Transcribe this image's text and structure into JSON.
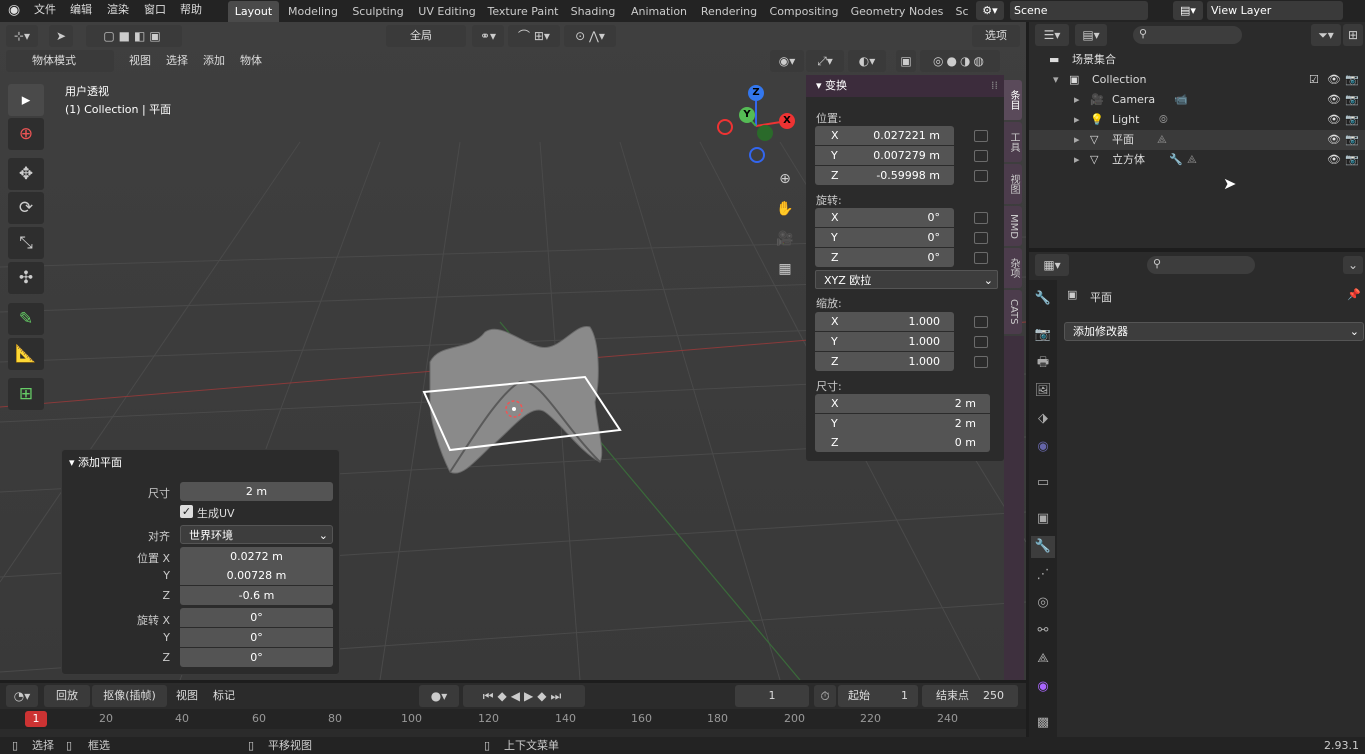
{
  "top_menu": {
    "items": [
      "文件",
      "编辑",
      "渲染",
      "窗口",
      "帮助"
    ],
    "workspaces": [
      "Layout",
      "Modeling",
      "Sculpting",
      "UV Editing",
      "Texture Paint",
      "Shading",
      "Animation",
      "Rendering",
      "Compositing",
      "Geometry Nodes",
      "Sc"
    ],
    "active_workspace": "Layout",
    "scene": "Scene",
    "view_layer": "View Layer"
  },
  "viewport_header": {
    "transform_orientation": "全局",
    "options_label": "选项",
    "mode": "物体模式",
    "menus": [
      "视图",
      "选择",
      "添加",
      "物体"
    ]
  },
  "viewport": {
    "view_name": "用户透视",
    "collection_info": "(1) Collection | 平面",
    "gizmo_axes": [
      "X",
      "Y",
      "Z"
    ]
  },
  "n_panel": {
    "title": "变换",
    "location_label": "位置:",
    "location": [
      {
        "axis": "X",
        "value": "0.027221 m"
      },
      {
        "axis": "Y",
        "value": "0.007279 m"
      },
      {
        "axis": "Z",
        "value": "-0.59998 m"
      }
    ],
    "rotation_label": "旋转:",
    "rotation": [
      {
        "axis": "X",
        "value": "0°"
      },
      {
        "axis": "Y",
        "value": "0°"
      },
      {
        "axis": "Z",
        "value": "0°"
      }
    ],
    "rotation_mode": "XYZ 欧拉",
    "scale_label": "缩放:",
    "scale": [
      {
        "axis": "X",
        "value": "1.000"
      },
      {
        "axis": "Y",
        "value": "1.000"
      },
      {
        "axis": "Z",
        "value": "1.000"
      }
    ],
    "dimensions_label": "尺寸:",
    "dimensions": [
      {
        "axis": "X",
        "value": "2 m"
      },
      {
        "axis": "Y",
        "value": "2 m"
      },
      {
        "axis": "Z",
        "value": "0 m"
      }
    ],
    "tabs": [
      "条目",
      "工具",
      "视图",
      "MMD",
      "杂项",
      "CATS"
    ]
  },
  "redo_panel": {
    "title": "添加平面",
    "size_label": "尺寸",
    "size": "2 m",
    "generate_uv_label": "生成UV",
    "generate_uv": true,
    "align_label": "对齐",
    "align": "世界环境",
    "location_label": "位置 X",
    "loc_y_label": "Y",
    "loc_z_label": "Z",
    "location": [
      "0.0272 m",
      "0.00728 m",
      "-0.6 m"
    ],
    "rotation_label": "旋转 X",
    "rot_y_label": "Y",
    "rot_z_label": "Z",
    "rotation": [
      "0°",
      "0°",
      "0°"
    ]
  },
  "timeline": {
    "playback": "回放",
    "keying": "抠像(插帧)",
    "view": "视图",
    "marker": "标记",
    "current_frame": "1",
    "start_label": "起始",
    "start": "1",
    "end_label": "结束点",
    "end": "250",
    "ruler": [
      "20",
      "40",
      "60",
      "80",
      "100",
      "120",
      "140",
      "160",
      "180",
      "200",
      "220",
      "240"
    ],
    "cursor_frame": "1"
  },
  "status_bar": {
    "select": "选择",
    "box_select": "框选",
    "pan_view": "平移视图",
    "context_menu": "上下文菜单",
    "version": "2.93.1"
  },
  "outliner": {
    "scene_collection": "场景集合",
    "items": [
      {
        "name": "Collection",
        "icon": "collection-icon"
      },
      {
        "name": "Camera",
        "icon": "camera-icon"
      },
      {
        "name": "Light",
        "icon": "light-icon"
      },
      {
        "name": "平面",
        "icon": "mesh-icon"
      },
      {
        "name": "立方体",
        "icon": "mesh-icon"
      }
    ]
  },
  "properties": {
    "object_name": "平面",
    "add_modifier": "添加修改器"
  }
}
